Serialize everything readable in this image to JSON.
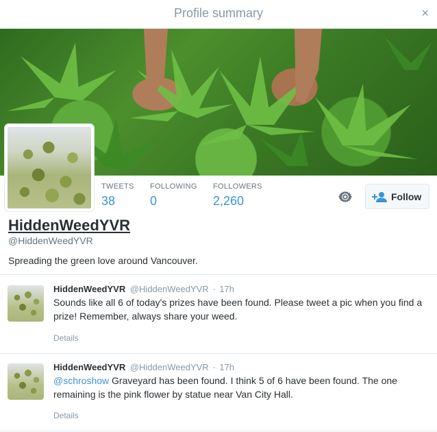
{
  "modal": {
    "title": "Profile summary",
    "close_glyph": "×",
    "close_icon": "close-icon"
  },
  "profile": {
    "display_name": "HiddenWeedYVR",
    "handle": "@HiddenWeedYVR",
    "bio": "Spreading the green love around Vancouver.",
    "stats": [
      {
        "label": "TWEETS",
        "value": "38"
      },
      {
        "label": "FOLLOWING",
        "value": "0"
      },
      {
        "label": "FOLLOWERS",
        "value": "2,260"
      }
    ],
    "follow_label": "Follow",
    "follow_icon": "add-user-icon",
    "settings_icon": "gear-icon"
  },
  "tweets": [
    {
      "name": "HiddenWeedYVR",
      "handle": "@HiddenWeedYVR",
      "separator": "·",
      "time": "17h",
      "mention": "",
      "text": "Sounds like all 6 of today's prizes have been found. Please tweet a pic when you find a prize! Remember, always share your weed.",
      "details_label": "Details"
    },
    {
      "name": "HiddenWeedYVR",
      "handle": "@HiddenWeedYVR",
      "separator": "·",
      "time": "17h",
      "mention": "@schroshow",
      "text": " Graveyard has been found. I think 5 of 6 have been found. The one remaining is the pink flower by statue near Van City Hall.",
      "details_label": "Details"
    }
  ],
  "colors": {
    "link": "#3b94d9",
    "muted": "#8899a6",
    "text": "#292f33",
    "border": "#e1e8ed"
  }
}
